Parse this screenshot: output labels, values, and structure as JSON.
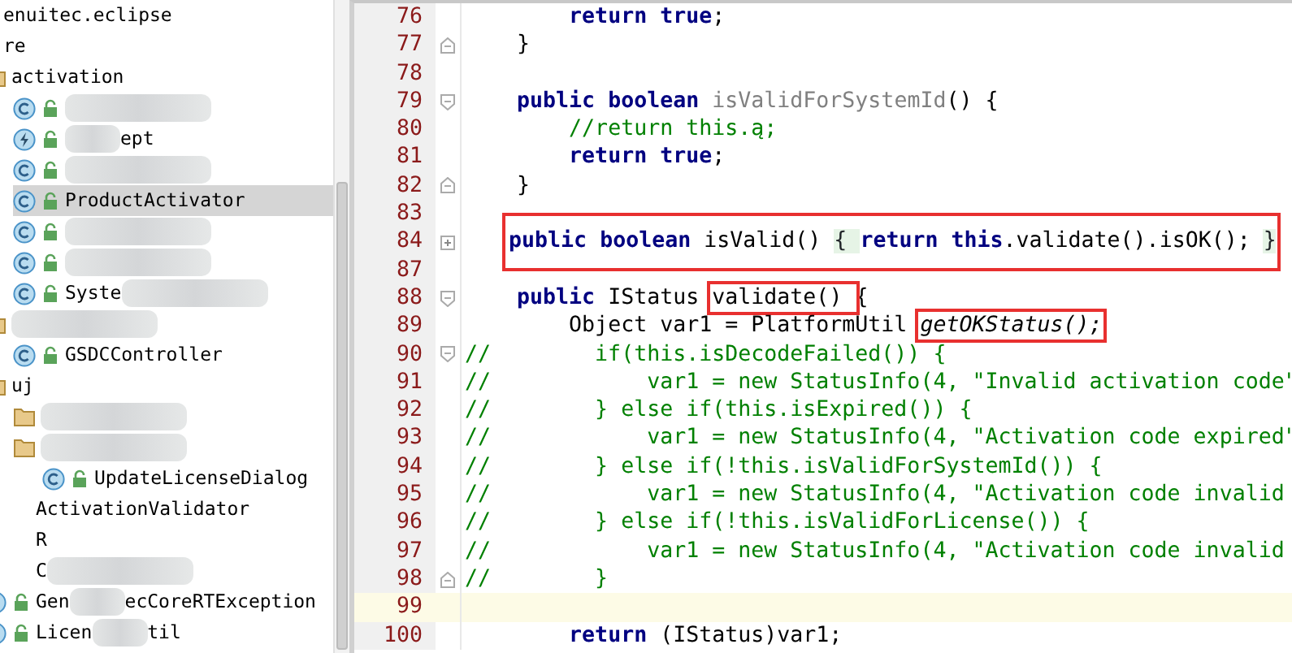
{
  "project_tree": [
    {
      "kind": "plain",
      "label": "enuitec.eclipse",
      "selected": false
    },
    {
      "kind": "plain",
      "label": "re",
      "selected": false,
      "children": [
        {
          "kind": "folder",
          "label": "activation",
          "selected": false,
          "children": [
            {
              "kind": "class",
              "blurred": true,
              "selected": false
            },
            {
              "kind": "exception",
              "blurred": true,
              "label_after": "ept",
              "selected": false
            },
            {
              "kind": "class",
              "blurred": true,
              "selected": false
            },
            {
              "kind": "class",
              "label": "ProductActivator",
              "selected": true
            },
            {
              "kind": "class",
              "blurred": true,
              "selected": false
            },
            {
              "kind": "class",
              "blurred": true,
              "selected": false
            },
            {
              "kind": "class",
              "label": "Syste",
              "blurred": true,
              "selected": false
            }
          ]
        },
        {
          "kind": "folder",
          "blurred": true,
          "selected": false,
          "children": [
            {
              "kind": "class",
              "label": "GSDCController",
              "selected": false
            }
          ]
        },
        {
          "kind": "folder",
          "label": "uj",
          "selected": false,
          "children": [
            {
              "kind": "folder",
              "blurred": true,
              "selected": false
            },
            {
              "kind": "folder",
              "blurred": true,
              "selected": false,
              "children": [
                {
                  "kind": "class",
                  "label": "UpdateLicenseDialog",
                  "selected": false
                }
              ]
            }
          ]
        },
        {
          "kind": "plain",
          "label": "ActivationValidator",
          "selected": false
        },
        {
          "kind": "plain",
          "label": "R",
          "selected": false
        },
        {
          "kind": "plain",
          "label": "C",
          "blurred": true,
          "selected": false
        },
        {
          "kind": "class",
          "label": "Gen",
          "blurred": true,
          "label_after": "ecCoreRTException",
          "selected": false
        },
        {
          "kind": "class",
          "label": "Licen",
          "blurred": true,
          "label_after": "til",
          "selected": false
        }
      ]
    }
  ],
  "editor": {
    "lines": [
      {
        "number": "76",
        "tokens": [
          {
            "kind": "keyword",
            "text": "        return true"
          },
          {
            "kind": "plain",
            "text": ";"
          }
        ]
      },
      {
        "number": "77",
        "fold_end": true,
        "tokens": [
          {
            "kind": "plain",
            "text": "    }"
          }
        ]
      },
      {
        "number": "78"
      },
      {
        "number": "79",
        "fold_start": true,
        "tokens": [
          {
            "kind": "keyword",
            "text": "    public boolean"
          },
          {
            "kind": "unused",
            "text": " isValidForSystemId"
          },
          {
            "kind": "plain",
            "text": "() {"
          }
        ]
      },
      {
        "number": "80",
        "tokens": [
          {
            "kind": "comment",
            "text": "        //return this.ą;"
          }
        ]
      },
      {
        "number": "81",
        "tokens": [
          {
            "kind": "keyword",
            "text": "        return true"
          },
          {
            "kind": "plain",
            "text": ";"
          }
        ]
      },
      {
        "number": "82",
        "fold_end": true,
        "tokens": [
          {
            "kind": "plain",
            "text": "    }"
          }
        ]
      },
      {
        "number": "83"
      },
      {
        "number": "84",
        "collapsed": true,
        "highlighted": true,
        "tokens": [
          {
            "kind": "keyword",
            "text": "    public boolean"
          },
          {
            "kind": "plain",
            "text": " isValid() "
          },
          {
            "kind": "folded",
            "text": "{ "
          },
          {
            "kind": "keyword",
            "text": "return this"
          },
          {
            "kind": "plain",
            "text": ".validate().isOK(); "
          },
          {
            "kind": "folded",
            "text": "}"
          }
        ]
      },
      {
        "number": "87"
      },
      {
        "number": "88",
        "fold_start": true,
        "tokens": [
          {
            "kind": "keyword",
            "text": "    public"
          },
          {
            "kind": "plain",
            "text": " IStatus "
          },
          {
            "kind": "plain",
            "text": "validate() ",
            "highlighted": true
          },
          {
            "kind": "plain",
            "text": "{"
          }
        ]
      },
      {
        "number": "89",
        "tokens": [
          {
            "kind": "plain",
            "text": "        Object var1 = PlatformUtil "
          },
          {
            "kind": "static",
            "text": "getOKStatus();",
            "highlighted": true
          }
        ]
      },
      {
        "number": "90",
        "fold_start": true,
        "tokens": [
          {
            "kind": "comment",
            "text": "//        if(this.isDecodeFailed()) {"
          }
        ]
      },
      {
        "number": "91",
        "tokens": [
          {
            "kind": "comment",
            "text": "//            var1 = new StatusInfo(4, \"Invalid activation code\""
          }
        ]
      },
      {
        "number": "92",
        "tokens": [
          {
            "kind": "comment",
            "text": "//        } else if(this.isExpired()) {"
          }
        ]
      },
      {
        "number": "93",
        "tokens": [
          {
            "kind": "comment",
            "text": "//            var1 = new StatusInfo(4, \"Activation code expired\""
          }
        ]
      },
      {
        "number": "94",
        "tokens": [
          {
            "kind": "comment",
            "text": "//        } else if(!this.isValidForSystemId()) {"
          }
        ]
      },
      {
        "number": "95",
        "tokens": [
          {
            "kind": "comment",
            "text": "//            var1 = new StatusInfo(4, \"Activation code invalid"
          }
        ]
      },
      {
        "number": "96",
        "tokens": [
          {
            "kind": "comment",
            "text": "//        } else if(!this.isValidForLicense()) {"
          }
        ]
      },
      {
        "number": "97",
        "tokens": [
          {
            "kind": "comment",
            "text": "//            var1 = new StatusInfo(4, \"Activation code invalid"
          }
        ]
      },
      {
        "number": "98",
        "fold_end": true,
        "tokens": [
          {
            "kind": "comment",
            "text": "//        }"
          }
        ]
      },
      {
        "number": "99",
        "current": true
      },
      {
        "number": "100",
        "tokens": [
          {
            "kind": "keyword",
            "text": "        return"
          },
          {
            "kind": "plain",
            "text": " (IStatus)var1;"
          }
        ]
      }
    ]
  }
}
